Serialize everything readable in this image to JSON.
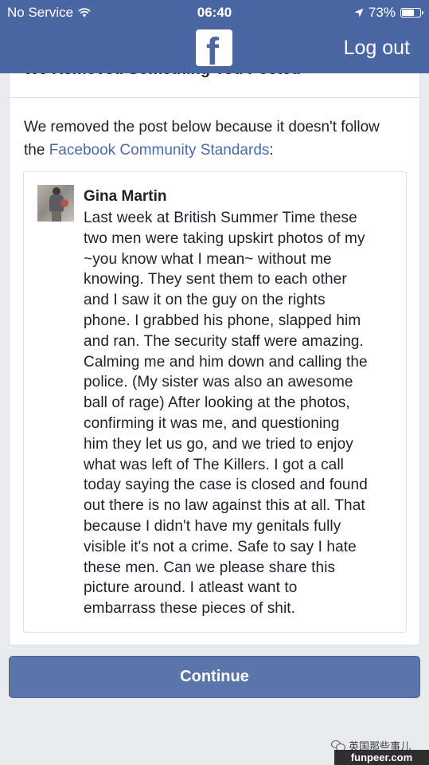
{
  "status_bar": {
    "carrier": "No Service",
    "time": "06:40",
    "battery_percent": "73%",
    "battery_level": 0.73
  },
  "header": {
    "logo_letter": "f",
    "logout_label": "Log out",
    "color": "#4a67a4"
  },
  "card": {
    "title": "We Removed Something You Posted",
    "intro_before": "We removed the post below because it doesn't follow the ",
    "intro_link": "Facebook Community Standards",
    "intro_after": ":",
    "link_color": "#4b6aa8"
  },
  "post": {
    "author": "Gina Martin",
    "lines": [
      "Last week at British Summer Time these",
      "two men were taking upskirt photos of my",
      "~you know what I mean~ without me",
      "knowing. They sent them to each other",
      "and I saw it on the guy on the rights",
      "phone. I grabbed his phone, slapped him",
      "and ran. The security staff were amazing.",
      "Calming me and him down and calling the",
      "police. (My sister was also an awesome",
      "ball of rage) After looking at the photos,",
      "confirming it was me, and questioning",
      "him they let us go, and we tried to enjoy",
      "what was left of The Killers. I got a call",
      "today saying the case is closed and found",
      "out there is no law against this at all. That",
      "because I didn't have my genitals fully",
      "visible it's not a crime. Safe to say I hate",
      "these men. Can we please share this",
      "picture around. I atleast want to",
      "embarrass these pieces of shit."
    ]
  },
  "continue_label": "Continue",
  "watermark": {
    "wechat_account": "英国那些事儿",
    "url": "funpeer.com"
  }
}
